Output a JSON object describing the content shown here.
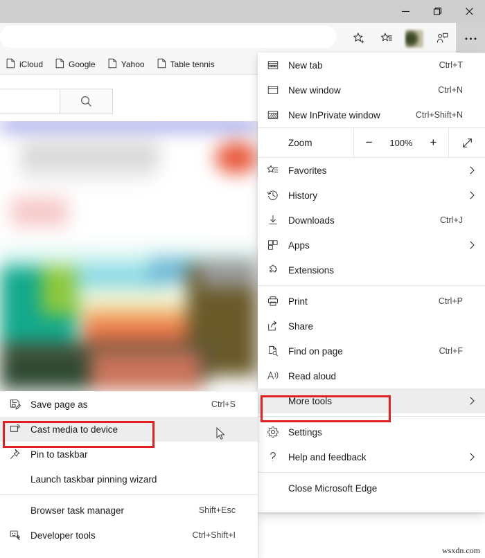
{
  "window": {
    "controls": [
      {
        "name": "minimize",
        "glyph": "minimize-icon"
      },
      {
        "name": "maximize",
        "glyph": "maximize-icon"
      },
      {
        "name": "close",
        "glyph": "close-icon"
      }
    ]
  },
  "toolbar": {
    "address_value": "",
    "icons": [
      {
        "name": "favorite-star-icon",
        "label": "Add this page to favorites"
      },
      {
        "name": "favorites-list-icon",
        "label": "Favorites"
      },
      {
        "name": "profile-avatar",
        "label": "Profile"
      },
      {
        "name": "collections-icon",
        "label": "Collections"
      },
      {
        "name": "settings-and-more-icon",
        "label": "Settings and more"
      }
    ]
  },
  "favorites_bar": {
    "items": [
      {
        "label": "iCloud",
        "icon": "page-icon"
      },
      {
        "label": "Google",
        "icon": "page-icon"
      },
      {
        "label": "Yahoo",
        "icon": "page-icon"
      },
      {
        "label": "Table tennis",
        "icon": "page-icon"
      }
    ]
  },
  "search_row": {
    "input_value": "",
    "search_button_icon": "search-icon"
  },
  "main_menu": {
    "groups": [
      {
        "items": [
          {
            "label": "New tab",
            "accel": "Ctrl+T",
            "icon": "new-tab-icon",
            "chevron": false
          },
          {
            "label": "New window",
            "accel": "Ctrl+N",
            "icon": "new-window-icon",
            "chevron": false
          },
          {
            "label": "New InPrivate window",
            "accel": "Ctrl+Shift+N",
            "icon": "inprivate-icon",
            "chevron": false
          }
        ]
      },
      {
        "zoom_row": {
          "label": "Zoom",
          "minus": "−",
          "value": "100%",
          "plus": "+",
          "fullscreen_icon": "fullscreen-icon"
        }
      },
      {
        "items": [
          {
            "label": "Favorites",
            "accel": "",
            "icon": "favorites-icon",
            "chevron": true
          },
          {
            "label": "History",
            "accel": "",
            "icon": "history-icon",
            "chevron": true
          },
          {
            "label": "Downloads",
            "accel": "Ctrl+J",
            "icon": "downloads-icon",
            "chevron": false
          },
          {
            "label": "Apps",
            "accel": "",
            "icon": "apps-icon",
            "chevron": true
          },
          {
            "label": "Extensions",
            "accel": "",
            "icon": "extensions-icon",
            "chevron": false
          }
        ]
      },
      {
        "items": [
          {
            "label": "Print",
            "accel": "Ctrl+P",
            "icon": "print-icon",
            "chevron": false
          },
          {
            "label": "Share",
            "accel": "",
            "icon": "share-icon",
            "chevron": false
          },
          {
            "label": "Find on page",
            "accel": "Ctrl+F",
            "icon": "find-icon",
            "chevron": false
          },
          {
            "label": "Read aloud",
            "accel": "",
            "icon": "read-aloud-icon",
            "chevron": false
          },
          {
            "label": "More tools",
            "accel": "",
            "icon": "",
            "chevron": true,
            "highlighted": true
          }
        ]
      },
      {
        "items": [
          {
            "label": "Settings",
            "accel": "",
            "icon": "gear-icon",
            "chevron": false
          },
          {
            "label": "Help and feedback",
            "accel": "",
            "icon": "help-icon",
            "chevron": true
          }
        ]
      },
      {
        "items": [
          {
            "label": "Close Microsoft Edge",
            "accel": "",
            "icon": "",
            "chevron": false
          }
        ]
      }
    ]
  },
  "more_tools_submenu": {
    "groups": [
      {
        "items": [
          {
            "label": "Save page as",
            "accel": "Ctrl+S",
            "icon": "save-page-icon"
          },
          {
            "label": "Cast media to device",
            "accel": "",
            "icon": "cast-icon",
            "highlighted": true
          },
          {
            "label": "Pin to taskbar",
            "accel": "",
            "icon": "pin-icon"
          },
          {
            "label": "Launch taskbar pinning wizard",
            "accel": "",
            "icon": ""
          }
        ]
      },
      {
        "items": [
          {
            "label": "Browser task manager",
            "accel": "Shift+Esc",
            "icon": ""
          },
          {
            "label": "Developer tools",
            "accel": "Ctrl+Shift+I",
            "icon": "devtools-icon"
          }
        ]
      }
    ]
  },
  "annotations": {
    "boxes": [
      {
        "target": "More tools",
        "color": "#e02020"
      },
      {
        "target": "Cast media to device",
        "color": "#e02020"
      }
    ]
  },
  "watermark": {
    "text": "wsxdn.com"
  }
}
